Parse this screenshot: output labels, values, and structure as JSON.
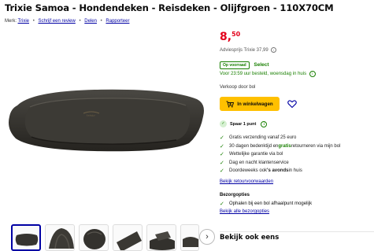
{
  "product": {
    "title": "Trixie Samoa - Hondendeken - Reisdeken - Olijfgroen - 110X70CM"
  },
  "meta": {
    "brand_label": "Merk:",
    "brand": "Trixie",
    "review_link": "Schrijf een review",
    "share_link": "Delen",
    "report_link": "Rapporteer"
  },
  "buy": {
    "price_int": "8,",
    "price_frac": "50",
    "advice": "Adviesprijs Trixie 37,99",
    "stock_badge": "Op voorraad",
    "select_label": "Select",
    "delivery": "Voor 23:59 uur besteld, woensdag in huis",
    "seller": "Verkoop door bol",
    "cart_button": "In winkelwagen",
    "spaar": "Spaar 1 punt",
    "returns_link": "Bekijk retourvoorwaarden",
    "bezorg_heading": "Bezorgopties",
    "bezorg_item": "Ophalen bij een bol afhaalpunt mogelijk",
    "bezorg_link": "Bekijk alle bezorgopties"
  },
  "usps": [
    {
      "pre": "Gratis verzending vanaf 25 euro",
      "bold": "",
      "post": ""
    },
    {
      "pre": "30 dagen bedenktijd en ",
      "bold": "gratis",
      "post": " retourneren via mijn bol"
    },
    {
      "pre": "Wettelijke garantie via bol",
      "bold": "",
      "post": ""
    },
    {
      "pre": "Dag en nacht klantenservice",
      "bold": "",
      "post": ""
    },
    {
      "pre": "Doordeweeks ook ",
      "bold": "'s avonds",
      "post": " in huis"
    }
  ],
  "section": {
    "also_look": "Bekijk ook eens"
  },
  "colors": {
    "price": "#e3001b",
    "link": "#0000a4",
    "cta": "#ffc000",
    "green": "#187f00",
    "blanket": "#363430"
  },
  "icons": [
    "info-icon",
    "cart-icon",
    "heart-icon",
    "check-icon",
    "chevron-right-icon"
  ]
}
